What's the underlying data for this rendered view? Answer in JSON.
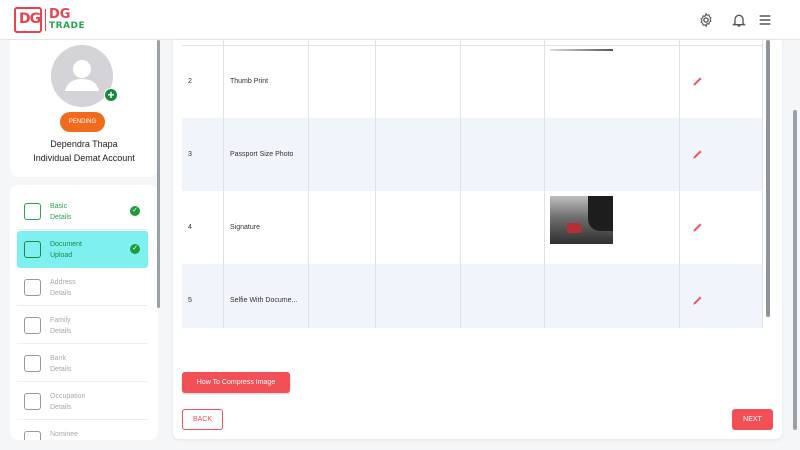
{
  "header": {
    "logo_top": "DG",
    "logo_bottom": "TRADE",
    "logo_mark": "DG",
    "icons": [
      "gear-icon",
      "bell-icon",
      "menu-icon"
    ]
  },
  "profile": {
    "status": "PENDING",
    "name": "Dependra Thapa",
    "account_type": "Individual Demat Account"
  },
  "steps": [
    {
      "label": "Basic\nDetails",
      "state": "done",
      "icon": "person-card-icon"
    },
    {
      "label": "Document\nUpload",
      "state": "active",
      "icon": "document-icon"
    },
    {
      "label": "Address\nDetails",
      "state": "pending",
      "icon": "location-pin-icon"
    },
    {
      "label": "Family\nDetails",
      "state": "pending",
      "icon": "family-icon"
    },
    {
      "label": "Bank\nDetails",
      "state": "pending",
      "icon": "bank-icon"
    },
    {
      "label": "Occupation\nDetails",
      "state": "pending",
      "icon": "briefcase-icon"
    },
    {
      "label": "Nominee",
      "state": "pending",
      "icon": "search-person-icon"
    }
  ],
  "documents": [
    {
      "no": "2",
      "name": "Thumb Print",
      "has_image": false
    },
    {
      "no": "3",
      "name": "Passport Size Photo",
      "has_image": false
    },
    {
      "no": "4",
      "name": "Signature",
      "has_image": true
    },
    {
      "no": "5",
      "name": "Selfie With Docume...",
      "has_image": false
    }
  ],
  "actions": {
    "compress": "How To Compress Image",
    "back": "BACK",
    "next": "NEXT"
  },
  "colors": {
    "brand_red": "#f25056",
    "brand_green": "#2aa44f",
    "pending_orange": "#f26b1d",
    "active_step": "#7ff0f0"
  }
}
